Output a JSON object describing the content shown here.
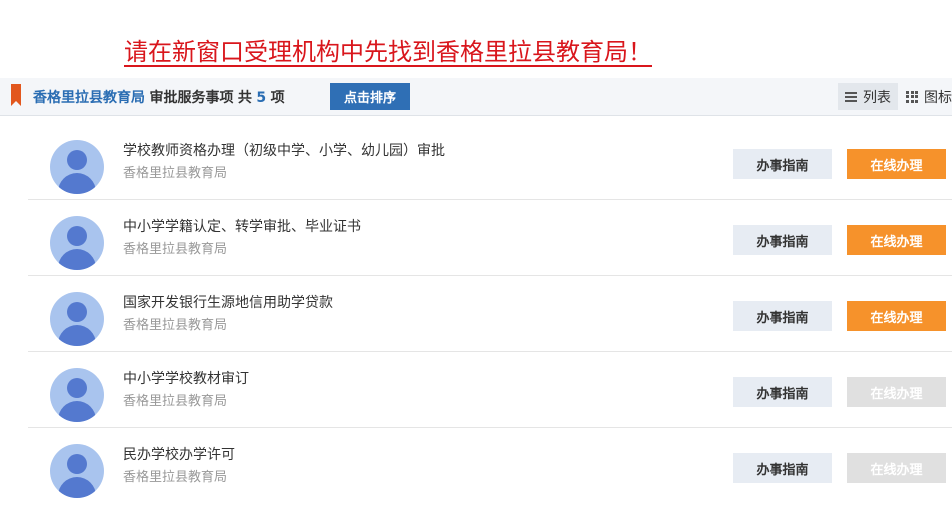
{
  "banner": "请在新窗口受理机构中先找到香格里拉县教育局！",
  "header": {
    "org": "香格里拉县教育局",
    "label": "审批服务事项",
    "count_prefix": "共",
    "count": "5",
    "count_suffix": "项",
    "sort_button": "点击排序",
    "view_list": "列表",
    "view_grid": "图标"
  },
  "colors": {
    "accent": "#2f6fb5",
    "action": "#f6922b",
    "disabled": "#e0e0e0",
    "banner": "#d9161c"
  },
  "items": [
    {
      "title": "学校教师资格办理（初级中学、小学、幼儿园）审批",
      "subtitle": "香格里拉县教育局",
      "guide": "办事指南",
      "online": "在线办理",
      "online_enabled": true
    },
    {
      "title": "中小学学籍认定、转学审批、毕业证书",
      "subtitle": "香格里拉县教育局",
      "guide": "办事指南",
      "online": "在线办理",
      "online_enabled": true
    },
    {
      "title": "国家开发银行生源地信用助学贷款",
      "subtitle": "香格里拉县教育局",
      "guide": "办事指南",
      "online": "在线办理",
      "online_enabled": true
    },
    {
      "title": "中小学学校教材审订",
      "subtitle": "香格里拉县教育局",
      "guide": "办事指南",
      "online": "在线办理",
      "online_enabled": false
    },
    {
      "title": "民办学校办学许可",
      "subtitle": "香格里拉县教育局",
      "guide": "办事指南",
      "online": "在线办理",
      "online_enabled": false
    }
  ]
}
